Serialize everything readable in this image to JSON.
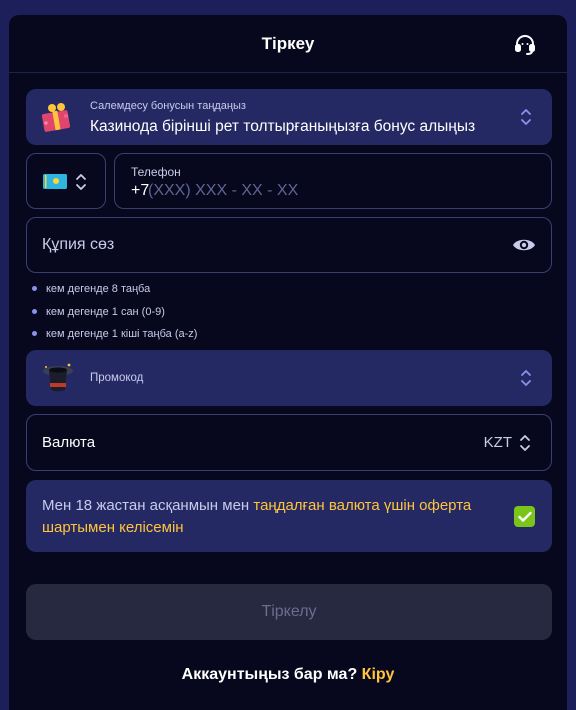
{
  "header": {
    "title": "Тіркеу",
    "support_icon": "headset-icon"
  },
  "bonus": {
    "caption": "Салемдесу бонусын таңдаңыз",
    "value": "Казинода бірінші рет толтырғаныңызға бонус алыңыз",
    "icon": "gift-icon"
  },
  "phone": {
    "country_icon": "kazakhstan-flag-icon",
    "label": "Телефон",
    "prefix": "+7",
    "placeholder": "(XXX) XXX - XX - XX"
  },
  "password": {
    "placeholder": "Құпия сөз",
    "icon": "eye-icon"
  },
  "password_rules": [
    "кем дегенде 8 таңба",
    "кем дегенде 1 сан (0-9)",
    "кем дегенде 1 кіші таңба (a-z)"
  ],
  "promo": {
    "label": "Промокод",
    "icon": "magic-hat-icon"
  },
  "currency": {
    "label": "Валюта",
    "value": "KZT"
  },
  "agreement": {
    "text_before": "Мен 18 жастан асқанмын мен ",
    "link_text": "таңдалған валюта үшін оферта шартымен келісемін",
    "checked": true
  },
  "submit": {
    "label": "Тіркелу"
  },
  "footer": {
    "question": "Аккаунтыңыз бар ма?",
    "login_link": "Кіру"
  },
  "colors": {
    "accent": "#ffc43d",
    "panel": "#242964",
    "background": "#07081d",
    "check": "#7bc51a"
  }
}
